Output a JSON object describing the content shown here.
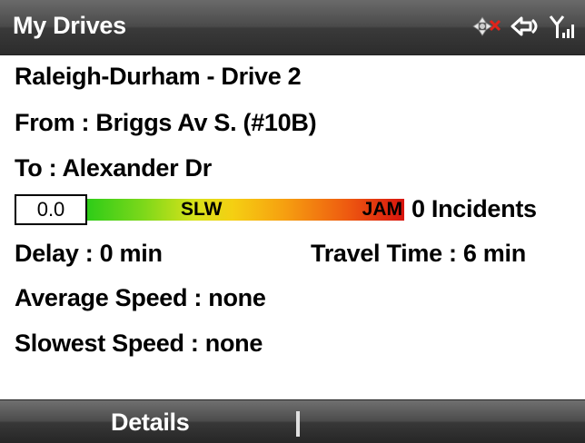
{
  "titlebar": {
    "title": "My Drives",
    "icons": [
      "move-icon",
      "no-signal-x-icon",
      "connectivity-icon",
      "signal-strength-icon"
    ]
  },
  "drive": {
    "name": "Raleigh-Durham - Drive 2",
    "from": "From : Briggs Av S. (#10B)",
    "to": "To : Alexander Dr"
  },
  "speed": {
    "value": "0.0",
    "label_slow": "SLW",
    "label_jam": "JAM",
    "incidents": "0 Incidents",
    "colors": [
      "#2ecc18",
      "#f5cf12",
      "#d8140e"
    ]
  },
  "stats": {
    "delay": "Delay : 0 min",
    "travel_time": "Travel Time : 6 min",
    "average_speed": "Average Speed : none",
    "slowest_speed": "Slowest Speed : none"
  },
  "softkeys": {
    "left": "Details",
    "right": ""
  }
}
